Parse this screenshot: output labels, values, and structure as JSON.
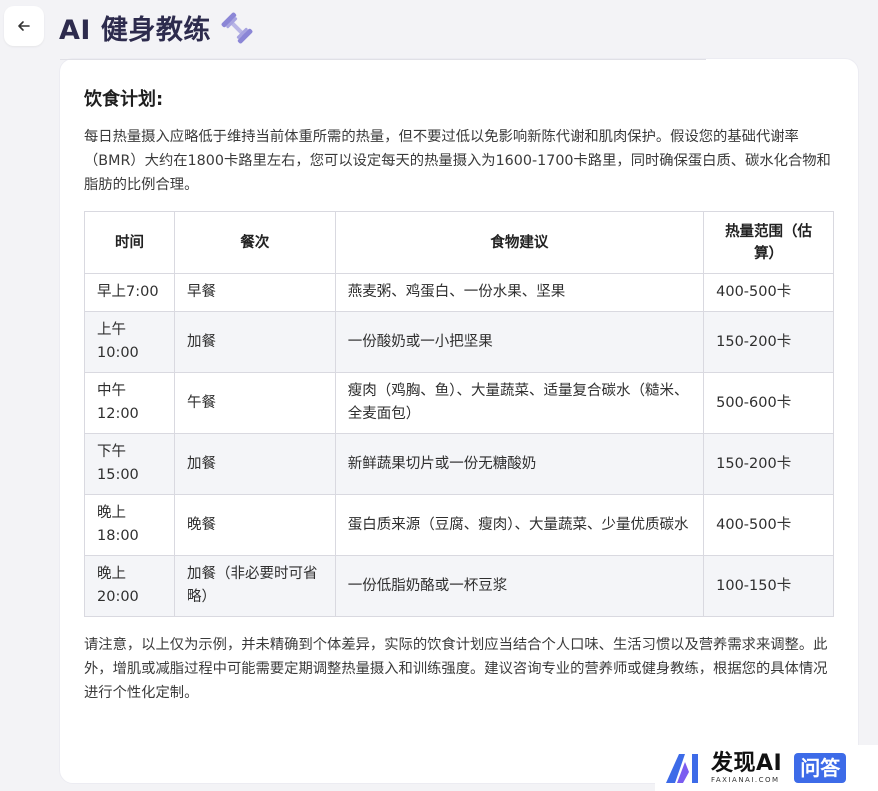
{
  "header": {
    "title": "AI 健身教练",
    "back_icon": "arrow-left-icon",
    "title_icon": "dumbbell-icon"
  },
  "content": {
    "section_title": "饮食计划:",
    "intro": "每日热量摄入应略低于维持当前体重所需的热量，但不要过低以免影响新陈代谢和肌肉保护。假设您的基础代谢率（BMR）大约在1800卡路里左右，您可以设定每天的热量摄入为1600-1700卡路里，同时确保蛋白质、碳水化合物和脂肪的比例合理。",
    "table": {
      "headers": [
        "时间",
        "餐次",
        "食物建议",
        "热量范围（估算）"
      ],
      "rows": [
        {
          "time": "早上7:00",
          "meal": "早餐",
          "food": "燕麦粥、鸡蛋白、一份水果、坚果",
          "calories": "400-500卡"
        },
        {
          "time": "上午10:00",
          "meal": "加餐",
          "food": "一份酸奶或一小把坚果",
          "calories": "150-200卡"
        },
        {
          "time": "中午12:00",
          "meal": "午餐",
          "food": "瘦肉（鸡胸、鱼）、大量蔬菜、适量复合碳水（糙米、全麦面包）",
          "calories": "500-600卡"
        },
        {
          "time": "下午15:00",
          "meal": "加餐",
          "food": "新鲜蔬果切片或一份无糖酸奶",
          "calories": "150-200卡"
        },
        {
          "time": "晚上18:00",
          "meal": "晚餐",
          "food": "蛋白质来源（豆腐、瘦肉）、大量蔬菜、少量优质碳水",
          "calories": "400-500卡"
        },
        {
          "time": "晚上20:00",
          "meal": "加餐（非必要时可省略）",
          "food": "一份低脂奶酪或一杯豆浆",
          "calories": "100-150卡"
        }
      ]
    },
    "note": "请注意，以上仅为示例，并未精确到个体差异，实际的饮食计划应当结合个人口味、生活习惯以及营养需求来调整。此外，增肌或减脂过程中可能需要定期调整热量摄入和训练强度。建议咨询专业的营养师或健身教练，根据您的具体情况进行个性化定制。"
  },
  "watermark": {
    "brand": "发现AI",
    "sub": "FAXIANAI.COM",
    "badge": "问答",
    "accent": "#3d6be8"
  },
  "colors": {
    "background": "#f3f3f6",
    "title": "#2d2b4d",
    "row_alt": "#f4f5f8",
    "border": "#d9d9e0"
  }
}
